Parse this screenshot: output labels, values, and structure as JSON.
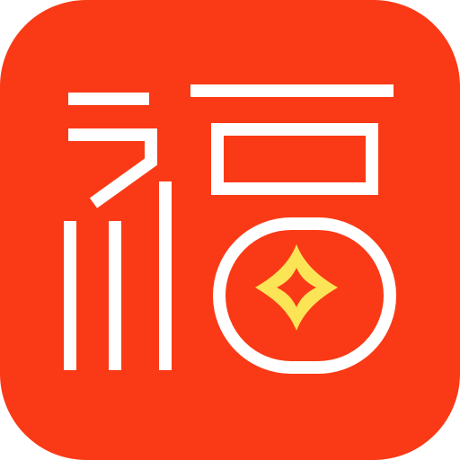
{
  "icon": {
    "semantic": "fu-character-app-icon",
    "glyph_logo_text": "福",
    "colors": {
      "background": "#FA3A16",
      "glyph": "#FFFFFF",
      "star_fill": "#FBE455",
      "star_inner": "#FA3A16"
    }
  }
}
